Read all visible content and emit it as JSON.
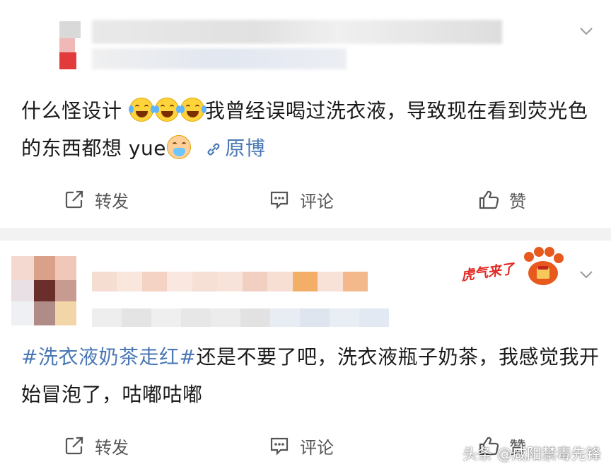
{
  "posts": [
    {
      "text_before": "什么怪设计 ",
      "text_after": "我曾经误喝过洗衣液，导致现在看到荧光色的东西都想 yue",
      "emojis": [
        "laugh-cry-emoji",
        "laugh-cry-emoji",
        "laugh-cry-emoji"
      ],
      "end_emoji": "sick-emoji",
      "link_label": "原博",
      "actions": {
        "repost": "转发",
        "comment": "评论",
        "like": "赞"
      }
    },
    {
      "topic": "#洗衣液奶茶走红#",
      "text": "还是不要了吧，洗衣液瓶子奶茶，我感觉我开始冒泡了，咕嘟咕嘟",
      "badge_text": "虎气来了",
      "actions": {
        "repost": "转发",
        "comment": "评论",
        "like": "赞"
      }
    }
  ],
  "watermark": "头条 @咸阳禁毒先锋",
  "colors": {
    "link": "#4a78b5",
    "text": "#1a1a1a",
    "action": "#555555",
    "separator": "#f2f2f2"
  }
}
